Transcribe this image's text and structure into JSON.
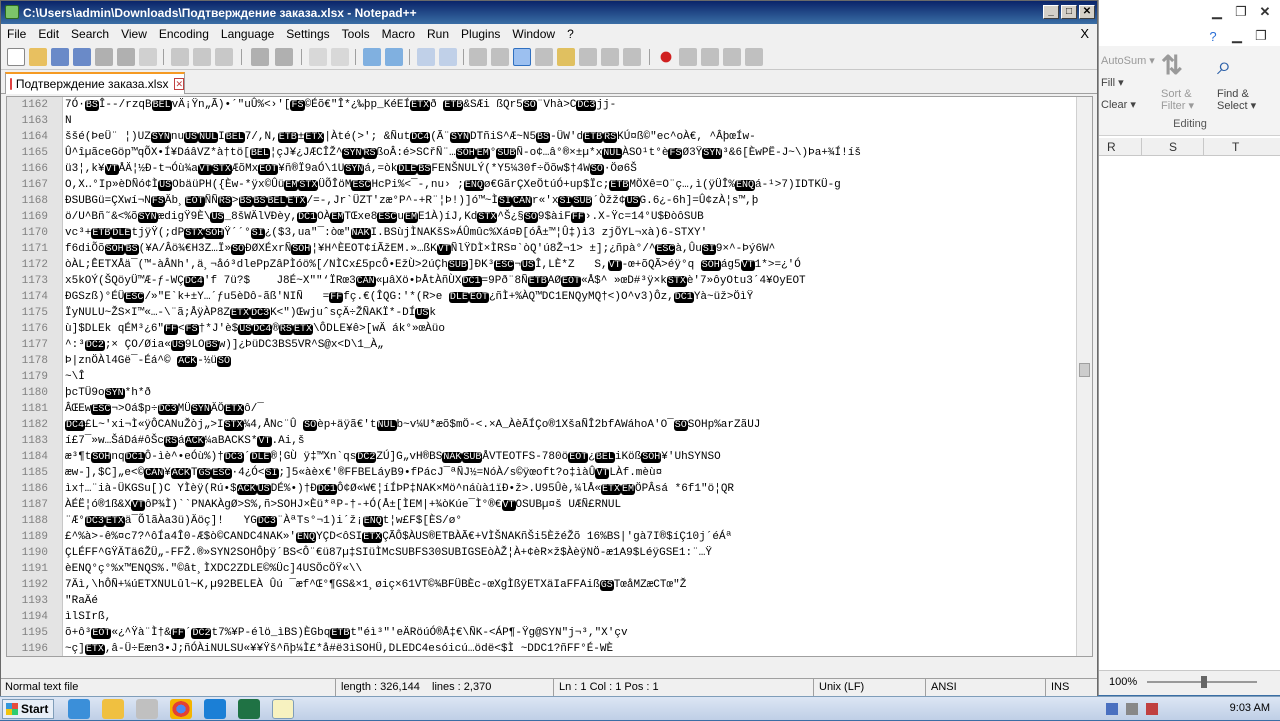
{
  "npp": {
    "title": "C:\\Users\\admin\\Downloads\\Подтверждение заказа.xlsx - Notepad++",
    "menu": [
      "File",
      "Edit",
      "Search",
      "View",
      "Encoding",
      "Language",
      "Settings",
      "Tools",
      "Macro",
      "Run",
      "Plugins",
      "Window",
      "?"
    ],
    "menu_close": "X",
    "tab_label": "Подтверждение заказа.xlsx",
    "status": {
      "type": "Normal text file",
      "length": "length : 326,144",
      "lines": "lines : 2,370",
      "position": "Ln : 1    Col : 1    Pos : 1",
      "eol": "Unix (LF)",
      "encoding": "ANSI",
      "ins": "INS"
    },
    "line_numbers": [
      "1162",
      "1163",
      "1164",
      "1165",
      "1166",
      "1167",
      "1168",
      "1169",
      "1170",
      "1171",
      "1172",
      "1173",
      "1174",
      "1175",
      "1176",
      "1177",
      "1178",
      "1179",
      "1180",
      "1181",
      "1182",
      "1183",
      "1184",
      "1185",
      "1186",
      "1187",
      "1188",
      "1189",
      "1190",
      "1191",
      "1192",
      "1193",
      "1194",
      "1195",
      "1196"
    ],
    "lines": [
      [
        "7Ó·",
        "BS",
        "Î--/rzqB",
        "BEL",
        "vÄ¡Ÿn„Ã)•´\"uÛ%<›'[",
        "FS",
        "©Éõ€\"Î*¿‰þp_KéEÍ",
        "ETX",
        "ð ",
        "ETB",
        "&SÆi ßQr5",
        "SO",
        "¨Vhà>C",
        "DC3",
        "jj-"
      ],
      [
        "N"
      ],
      [
        "ššé(ÞeÜ¨ ¦)UZ",
        "SYN",
        "nu",
        "US",
        "NUL",
        "I",
        "BEL",
        "7/,N,",
        "ETB",
        "±",
        "ETX",
        "|Àté(>'; &Ñut",
        "DC4",
        "(Ã¨",
        "SYN",
        "DTñiS^Æ~N5",
        "BS",
        "-ÜW'd",
        "ETB",
        "RS",
        "KÚ¤ß©\"ec^oÀ€, ^ÂþœÍw-"
      ],
      [
        "Û^îµãceGöp™qÕX•Í¥DáâVZ*à†tö[",
        "BEL",
        "¦çJ¥¿JÆCÎŽ^",
        "SYN",
        "RS",
        "ßoÂ:é>SCřÑ¨…",
        "SOH",
        "EM",
        "°",
        "SUB",
        "Ñ-o¢…â°®×±µ*x",
        "NUL",
        "ÀSO¹t°è",
        "FS",
        "Ø3Ÿ",
        "SYN",
        "³&6[ÈwPË-J~\\)Þa+¾Í!íš"
      ],
      [
        "ü3¦,k¥",
        "VT",
        "ÅÄ¦½Ð-t¬Óù¾a",
        "VT",
        "STX",
        "ÆõMx",
        "EOT",
        "¥ñ®Ï9aÓ\\1U",
        "SYN",
        "á,=òk",
        "DLE",
        "BS",
        "F",
        "EN",
        "ŠNUL",
        "Ý(*Y5¼30f÷Öõw$†4W",
        "SO",
        "·Öø6Š"
      ],
      [
        "O,X‥°Ip»èDÑó¢Ì",
        "US",
        "ObäüPH({Èw-*ÿx©Ûü",
        "EM",
        "STX",
        "ÜÕÎöM",
        "ESC",
        "HcPi%<¯-,nu› ;",
        "ENQ",
        "ø€GãrÇXeÖtúÓ+up$Ïc;",
        "ETB",
        "MÖXê=O¨ç…,ì(ÿÜÎ%",
        "ENQ",
        "á-¹>7)IDTKÜ-g"
      ],
      [
        "ÐSUB",
        "Gü=ÇXwí¬N",
        "FS",
        "Äb¸",
        "EOT",
        "ÑÑ",
        "RS",
        ">",
        "BS",
        "BS",
        "BEL",
        "ETX",
        "/=-,Jr`ÜZT'zæ°P^-+R¨¦Þ!)]ó™~Ì",
        "SI",
        "CAN",
        "r«'x",
        "SI",
        "SUB",
        "´Òžž¢",
        "US",
        "G.6¿-6h]=Û¢zÀ¦s™,þ"
      ],
      [
        "ö/U^Bñ˜&<%õ",
        "SYN",
        "ædigŸ9È\\",
        "US",
        "_8šWÄlVÐèy,",
        "DC1",
        "OÀ",
        "EM",
        "TŒxe8",
        "ESC",
        "u",
        "EM",
        "E1À)íJ,Kd",
        "STX",
        "^Š¿§",
        "SO",
        "9$àiF",
        "FF",
        "›.X-Ÿc=14°U$ÐòôSUB"
      ],
      [
        "vc³+",
        "ETB",
        "DLE",
        "tjÿŸ(;dP",
        "STX",
        "SOH",
        "Ÿ´´°",
        "SI",
        "¿($3,ua\"¯:òœ\"",
        "NAK",
        "I.BSùjÌNAKšS»ÁÛmûc%Xá¤Ð[óÂ±™¦Û‡)ì3 zjÖYL¬xà)6-STXY'"
      ],
      [
        "f6diÕõ",
        "SOH",
        "BS",
        "(¥A/Âö¾€H3Z…Ï»",
        "SO",
        "ÐØXÉxr",
        "Ñ",
        "SOH",
        "¦¥H^ÈEOT¢íÃžE",
        "M",
        ".»…ßK",
        "VT",
        "ÑlŸDÌ×ÌRS¤`òQ'ú8Ž¬1> ±];¿ñpà°/^",
        "ESC",
        "à,Ûu",
        "SI",
        "9×^-Þý6W^"
      ],
      [
        "òÀL;ÊETX",
        "Åä¯(™-àÂNh',ä¸¬åó³dlePpZâPÌóö%[/NÌCx£5pcÔ•EžÙ>2úÇh",
        "SUB",
        "]ÐK³",
        "ESC",
        "¬",
        "US",
        "Î,LÈ*Z   S,",
        "VT",
        "-œ+õQÃ>éÿ°q ",
        "SOH",
        "ág5",
        "VT",
        "1*>=¿'Ó"
      ],
      [
        "x5kOÝ(ŠQöyÜ™Æ-ƒ-WÇ",
        "DC4",
        "'f 7ü?$    J8É~X\"\"‘ÏRœ3",
        "CAN",
        "«µâXö•ÞÅtÀñÙX",
        "DC1",
        "=9Pð¨8Ñ",
        "ETB",
        "AØ",
        "EOT",
        "«Å$^ »œD#³ÿ×k",
        "STX",
        "è'7»ôyOtu3´4¥OyEOT"
      ],
      [
        "ÐGSzß)°ÉÜ",
        "ESC",
        "/»\"E`k+±Y…´ƒu5èDô-ãß'NIÑ   =",
        "FF",
        "fç.€(ÎQG:'*(R>e ",
        "DLE",
        "EOT",
        "¿ñÌ+%ÀQ™DC1ENQyMQ†<)O^v3)Ôz,",
        "DC1",
        "Yà~üž>ÖìŸ"
      ],
      [
        "ÏyNUL",
        "U~ŽS×I™«…-\\¨ã;ÅÿÀP8Z",
        "ETX",
        "DC3",
        "K<\")ŒwjuˆsçÄ÷ŽÑAKÏ*-DÍ",
        "US",
        "k"
      ],
      [
        "ù]",
        "$DLE",
        "k qÉM³¿6\"",
        "FF",
        "<",
        "FS",
        "†*J'è$",
        "US",
        "DC4",
        "®",
        "RS",
        "ETX",
        "\\ÔDLE",
        "¥ê>[wÄ ák°»œÀüo"
      ],
      [
        "^:³",
        "DC2",
        ";× ÇO/Øia«",
        "US",
        "9LO",
        "BS",
        "w)]¿ÞüDC3BS5VR^S@x<D\\1_À„"
      ],
      [
        "Þ|znÖÀl4Gë¯-Éá^© ",
        "ACK",
        "-½ü",
        "SO"
      ],
      [
        "~\\Î"
      ],
      [
        "þcTÜ9o",
        "SYN",
        "*h*ð"
      ],
      [
        "ÂŒEw",
        "ESC",
        "¬>Oá$p÷",
        "DC3",
        "MÜ",
        "SYN",
        "ÄÖ",
        "ETX",
        "ô/¯"
      ],
      [
        "DC4",
        "£L~'xi¬Ì«ÿÔCANuŽòj„>I",
        "STX",
        "¾4,ÅNc¨Û ",
        "SO",
        "èp+äÿã€'t",
        "NUL",
        "b~v¼U*æõ$mÖ-<.×A_ÀèÃÍÇo®1XšaÑÎ2bfAWáhoA'O¯",
        "SO",
        "SOHp%arZãUJ"
      ],
      [
        "í£7¯»w…ŠáDá#ôŠc",
        "RS",
        "á",
        "ACK",
        "¼a",
        "BACK",
        "S*",
        "VT",
        ".Ai,š"
      ],
      [
        "æ³¶t",
        "SOH",
        "nq",
        "DC1",
        "Ô-ìè^•eÓù%)†",
        "DC3",
        "´",
        "DLE",
        "®¦GÙ ÿ‡™Xn`qs",
        "DC2",
        "ZÚ]G„vH®BS",
        "NAK",
        "SUB",
        "ÅVTEOTFS-780ö",
        "EOT",
        "¿",
        "BEL",
        "iKöß",
        "SOH",
        "¥'UhSYNSO"
      ],
      [
        "æw-],$C]„e<©",
        "CAN",
        "¥",
        "ACK",
        "T",
        "GS",
        "ESC",
        "·4¿Ó<",
        "SI",
        ";]5«àèx€'®FFBELáyB9•fPácJ¯ªÑJ½=NóÀ/s©ÿœoft?o‡ìàÛ",
        "VT",
        "LÀf.mèù¤"
      ],
      [
        "ìx†…¨ià-Ü",
        "KG",
        "Su[)C YÌèÿ(Rú•$",
        "ACK",
        "US",
        "DÉ%•)†Ð",
        "DC1",
        "Ô¢Ø«W€¦íÍÞP‡NAK×Mö^náùà1ïÐ•ž>.U95Ûè,¼lÅ«",
        "ETX",
        "EM",
        "ÖPÂsá *6f1\"ö¦QR"
      ],
      [
        "ÀÉË¦ó®1ß&X",
        "VT",
        "ôP¾Ì)``PNAKÀgØ>S%,ñ>SOHJ×Èü*ªP-†-+Ó(Å±[ÌEM|+¾òKúe¯Ì°®€",
        "VT",
        "OSUBµ¤š UÆÑ£RNUL"
      ],
      [
        "¨Æ°",
        "DC3",
        "ETX",
        "ä¯ÕlãÀa3ü)Äöç]!   YG",
        "DC3",
        "¨ÀªTs°¬1)i´ž¡",
        "ENQ",
        "t¦w£F$[ÈS/ø°"
      ],
      [
        "£^%à>-ê%¤c7?^ôÍa4Î0-Æ$ò©CANDC4NAK»'",
        "ENQ",
        "YÇD<ôSI",
        "ETX",
        "ÇÃÔ$ÀUS®ETBÀÃ€+VÌŠNAKñŠi5ÈžéŽõ 16%BS|'gà7I®$íÇ10j´éÁª"
      ],
      [
        "ÇLÉFF^GŸÄTä6ŽÜ„-FF",
        "Ž.®»SYN2SOHÔþÿ´BS<Ô¨€ü87µ‡SIüÌMcSUBFS30SUBIGSEòÀŽ¦À+¢èR×ž$ÀèÿNÖ-æ1A9$LéÿGSE1:¨…Ÿ"
      ],
      [
        "èENQ°ç°%x™ENQS%.\"©ât¸ÌXDC2ZDLE©%Üc]4USÖcÖŸ«\\\\"
      ],
      [
        "7Äì,\\hÔÑ+¼úETXNUL",
        "ûl~K,µ92BELEÀ Ûú ¯æf^Œ°¶GS&×1¸øiç×61VT©¾BFÜBÈc-œXgÌßÿETXäIaFFAiß",
        "GS",
        "TœåMZæCTœ\"Ž"
      ],
      [
        "\"RaÄé"
      ],
      [
        "ìlSIrß,"
      ],
      [
        "õ+ô³",
        "EOT",
        "«¿^Ÿà¨Ì†&",
        "FF",
        "´",
        "DC2",
        "t7%¥P-élö_ìBS)ÈGbq",
        "ETB",
        "t\"éì³\"'eÄRöúÓ®Å‡€\\ÑK-<ÁP¶-Ÿg@SYN\"j¬³,\"X'çv"
      ],
      [
        "~ç]",
        "ETX",
        ",â-Ü÷Eæn3•J;ñÓÀiNULSU«¥¥Ÿš^ñþ¼Ì£*å#ë3ìSOHÜ,DLEDC4esóicú…ödë<$Ì ~DDC1?ñFF°É-WÈ"
      ]
    ]
  },
  "excel": {
    "autosum": "AutoSum",
    "fill": "Fill",
    "clear": "Clear",
    "sort_filter": "Sort &\nFilter",
    "find_select": "Find &\nSelect",
    "editing": "Editing",
    "columns": [
      "R",
      "S",
      "T"
    ],
    "zoom": "100%"
  },
  "taskbar": {
    "start": "Start",
    "clock": "9:03 AM"
  }
}
